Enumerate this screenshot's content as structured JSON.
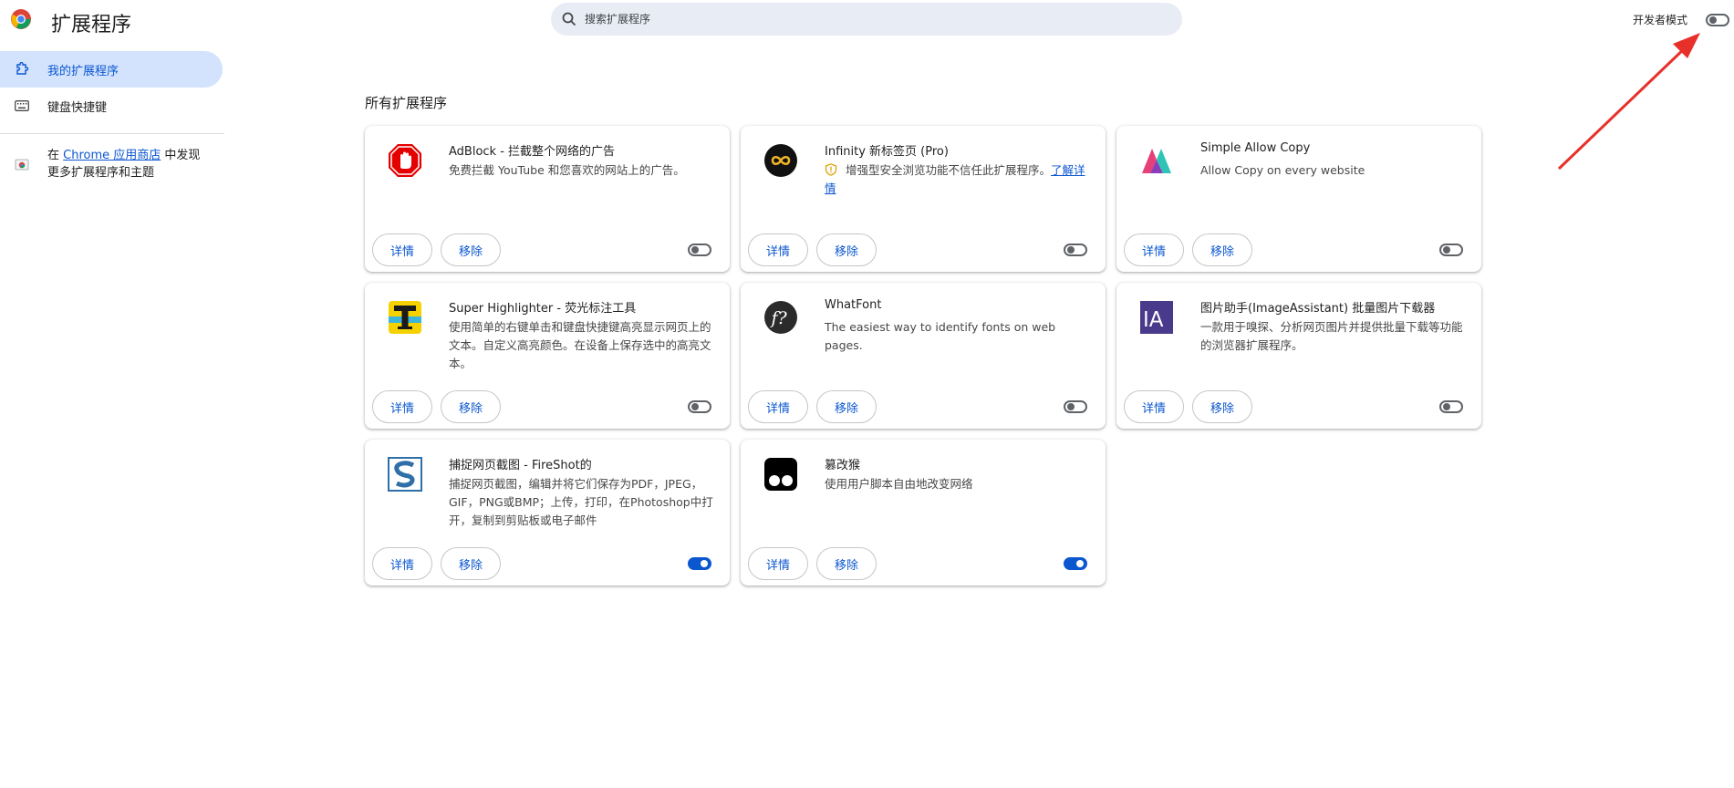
{
  "header": {
    "title": "扩展程序",
    "search_placeholder": "搜索扩展程序",
    "dev_mode_label": "开发者模式"
  },
  "sidebar": {
    "items": [
      {
        "label": "我的扩展程序",
        "icon": "puzzle-icon"
      },
      {
        "label": "键盘快捷键",
        "icon": "keyboard-icon"
      }
    ],
    "store": {
      "prefix": "在 ",
      "link": "Chrome 应用商店",
      "suffix": " 中发现更多扩展程序和主题"
    }
  },
  "main": {
    "section_title": "所有扩展程序",
    "details_label": "详情",
    "remove_label": "移除",
    "extensions": [
      {
        "name": "AdBlock - 拦截整个网络的广告",
        "description": "免费拦截 YouTube 和您喜欢的网站上的广告。",
        "enabled": false,
        "icon": "adblock-icon"
      },
      {
        "name": "Infinity 新标签页 (Pro)",
        "description": "增强型安全浏览功能不信任此扩展程序。",
        "link": "了解详情",
        "warning": true,
        "enabled": false,
        "icon": "infinity-icon"
      },
      {
        "name": "Simple Allow Copy",
        "description": "Allow Copy on every website",
        "enabled": false,
        "icon": "simple-allow-copy-icon"
      },
      {
        "name": "Super Highlighter - 荧光标注工具",
        "description": "使用简单的右键单击和键盘快捷键高亮显示网页上的文本。自定义高亮颜色。在设备上保存选中的高亮文本。",
        "enabled": false,
        "icon": "super-highlighter-icon"
      },
      {
        "name": "WhatFont",
        "description": "The easiest way to identify fonts on web pages.",
        "enabled": false,
        "icon": "whatfont-icon"
      },
      {
        "name": "图片助手(ImageAssistant) 批量图片下载器",
        "description": "一款用于嗅探、分析网页图片并提供批量下载等功能的浏览器扩展程序。",
        "enabled": false,
        "icon": "image-assistant-icon"
      },
      {
        "name": "捕捉网页截图 - FireShot的",
        "description": "捕捉网页截图，编辑并将它们保存为PDF，JPEG，GIF，PNG或BMP；上传，打印，在Photoshop中打开，复制到剪贴板或电子邮件",
        "enabled": true,
        "icon": "fireshot-icon"
      },
      {
        "name": "篡改猴",
        "description": "使用用户脚本自由地改变网络",
        "enabled": true,
        "icon": "tampermonkey-icon"
      }
    ]
  },
  "colors": {
    "accent": "#0b57d0",
    "nav_active_bg": "#d3e3fd",
    "search_bg": "#e8ecf5",
    "annotation_arrow": "#e8302a"
  }
}
